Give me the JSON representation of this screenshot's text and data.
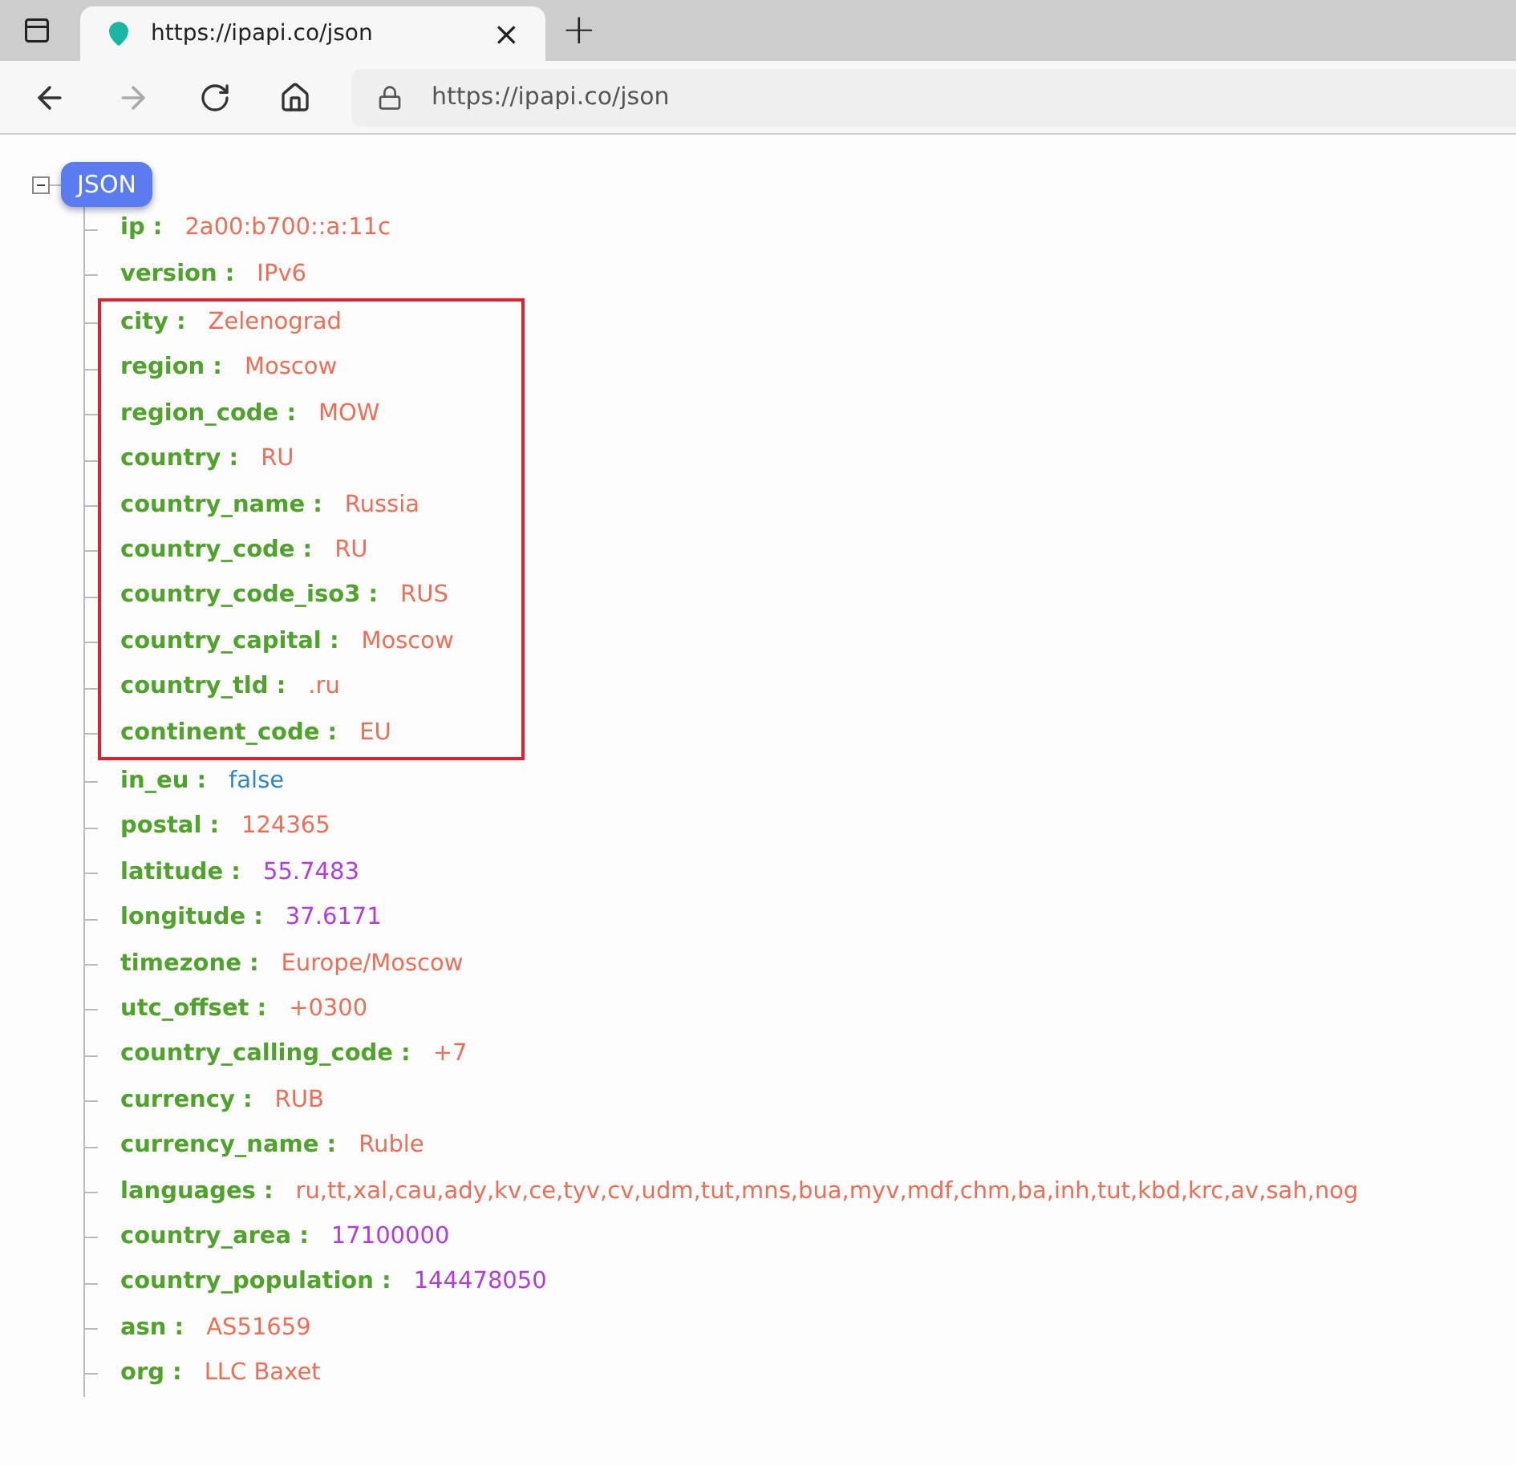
{
  "tab": {
    "title": "https://ipapi.co/json",
    "close": "×",
    "new_tab": "+"
  },
  "address_bar": {
    "url": "https://ipapi.co/json"
  },
  "tree": {
    "root": "JSON",
    "expanded": true,
    "items": [
      {
        "kind": "string",
        "key": "ip :",
        "value": "2a00:b700::a:11c"
      },
      {
        "kind": "string",
        "key": "version :",
        "value": "IPv6"
      },
      {
        "kind": "framed_group",
        "rows": [
          {
            "kind": "string",
            "key": "city :",
            "value": "Zelenograd"
          },
          {
            "kind": "string",
            "key": "region :",
            "value": "Moscow"
          },
          {
            "kind": "string",
            "key": "region_code :",
            "value": "MOW"
          },
          {
            "kind": "string",
            "key": "country :",
            "value": "RU"
          },
          {
            "kind": "string",
            "key": "country_name :",
            "value": "Russia"
          },
          {
            "kind": "string",
            "key": "country_code :",
            "value": "RU"
          },
          {
            "kind": "string",
            "key": "country_code_iso3 :",
            "value": "RUS"
          },
          {
            "kind": "string",
            "key": "country_capital :",
            "value": "Moscow"
          },
          {
            "kind": "string",
            "key": "country_tld :",
            "value": ".ru"
          },
          {
            "kind": "string",
            "key": "continent_code :",
            "value": "EU"
          }
        ]
      },
      {
        "kind": "boolean",
        "key": "in_eu :",
        "value": "false"
      },
      {
        "kind": "string",
        "key": "postal :",
        "value": "124365"
      },
      {
        "kind": "number",
        "key": "latitude :",
        "value": "55.7483"
      },
      {
        "kind": "number",
        "key": "longitude :",
        "value": "37.6171"
      },
      {
        "kind": "string",
        "key": "timezone :",
        "value": "Europe/Moscow"
      },
      {
        "kind": "string",
        "key": "utc_offset :",
        "value": "+0300"
      },
      {
        "kind": "string",
        "key": "country_calling_code :",
        "value": "+7"
      },
      {
        "kind": "string",
        "key": "currency :",
        "value": "RUB"
      },
      {
        "kind": "string",
        "key": "currency_name :",
        "value": "Ruble"
      },
      {
        "kind": "string",
        "key": "languages :",
        "value": "ru,tt,xal,cau,ady,kv,ce,tyv,cv,udm,tut,mns,bua,myv,mdf,chm,ba,inh,tut,kbd,krc,av,sah,nog"
      },
      {
        "kind": "number",
        "key": "country_area :",
        "value": "17100000"
      },
      {
        "kind": "number",
        "key": "country_population :",
        "value": "144478050"
      },
      {
        "kind": "string",
        "key": "asn :",
        "value": "AS51659"
      },
      {
        "kind": "string",
        "key": "org :",
        "value": "LLC Baxet"
      }
    ]
  }
}
